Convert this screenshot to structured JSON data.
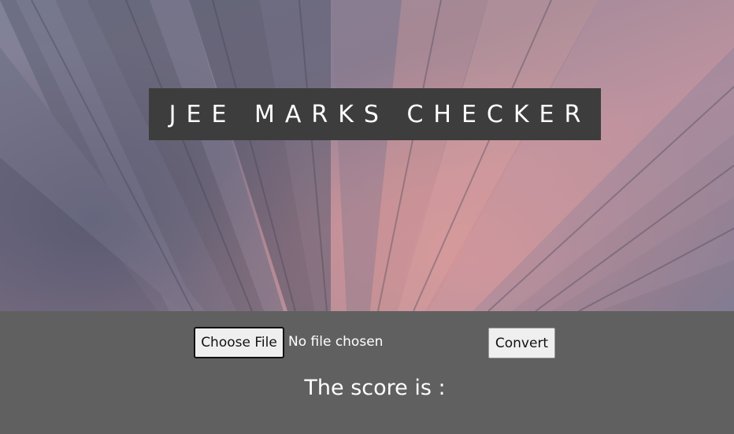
{
  "hero": {
    "title": "JEE MARKS CHECKER",
    "background_image": "open-book-pages-photo"
  },
  "upload": {
    "choose_file_label": "Choose File",
    "file_status": "No file chosen",
    "convert_label": "Convert"
  },
  "result": {
    "score_label": "The score is :"
  },
  "colors": {
    "title_box": "#3d3d3d",
    "bottom_panel": "#606060",
    "text": "#ffffff"
  }
}
